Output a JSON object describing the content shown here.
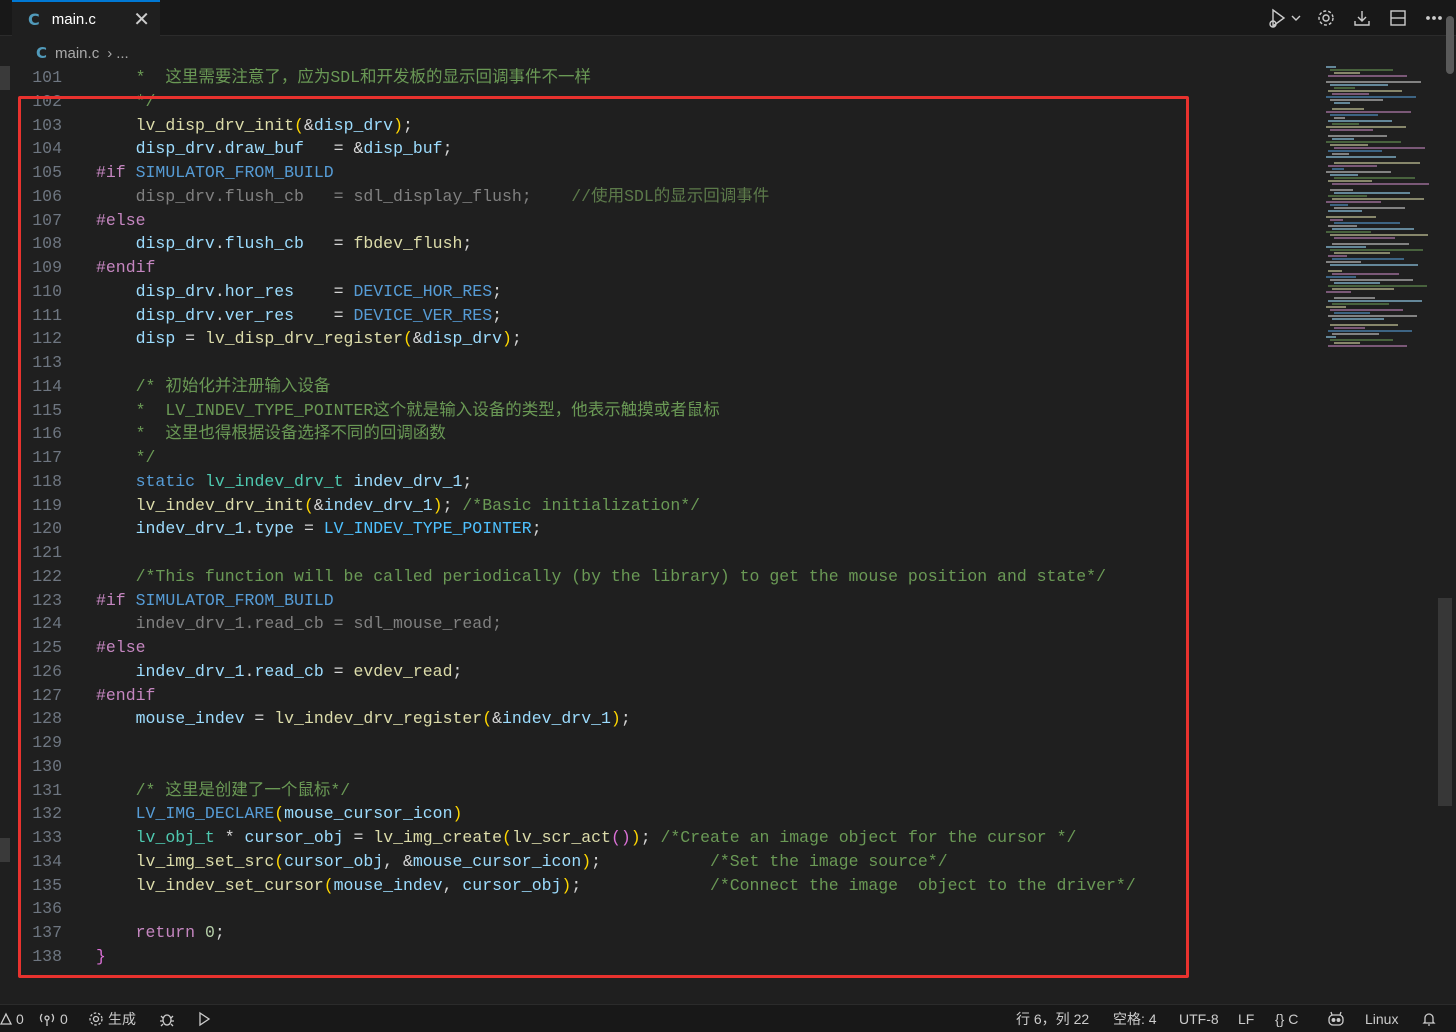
{
  "tab": {
    "icon": "C",
    "label": "main.c",
    "close": "✕"
  },
  "toolbar": [
    "run-debug-icon",
    "chevron-down-icon",
    "gear-icon",
    "download-icon",
    "split-editor-icon",
    "more-icon"
  ],
  "breadcrumb": {
    "icon": "C",
    "file": "main.c",
    "separator": "›",
    "more": "..."
  },
  "editor": {
    "lines": [
      {
        "n": "101",
        "seg": [
          {
            "t": "    ",
            "c": "#d4d4d4"
          },
          {
            "t": "*  这里需要注意了，应为SDL和开发板的显示回调事件不一样",
            "c": "#6a9955"
          }
        ]
      },
      {
        "n": "102",
        "seg": [
          {
            "t": "    ",
            "c": "#d4d4d4"
          },
          {
            "t": "*/",
            "c": "#6a9955"
          }
        ]
      },
      {
        "n": "103",
        "seg": [
          {
            "t": "    ",
            "c": "#d4d4d4"
          },
          {
            "t": "lv_disp_drv_init",
            "c": "#dcdcaa"
          },
          {
            "t": "(",
            "c": "#ffd700"
          },
          {
            "t": "&",
            "c": "#d4d4d4"
          },
          {
            "t": "disp_drv",
            "c": "#9cdcfe"
          },
          {
            "t": ")",
            "c": "#ffd700"
          },
          {
            "t": ";",
            "c": "#d4d4d4"
          }
        ]
      },
      {
        "n": "104",
        "seg": [
          {
            "t": "    ",
            "c": "#d4d4d4"
          },
          {
            "t": "disp_drv",
            "c": "#9cdcfe"
          },
          {
            "t": ".",
            "c": "#d4d4d4"
          },
          {
            "t": "draw_buf",
            "c": "#9cdcfe"
          },
          {
            "t": "   = &",
            "c": "#d4d4d4"
          },
          {
            "t": "disp_buf",
            "c": "#9cdcfe"
          },
          {
            "t": ";",
            "c": "#d4d4d4"
          }
        ]
      },
      {
        "n": "105",
        "seg": [
          {
            "t": "#if ",
            "c": "#c586c0"
          },
          {
            "t": "SIMULATOR_FROM_BUILD",
            "c": "#569cd6"
          }
        ]
      },
      {
        "n": "106",
        "seg": [
          {
            "t": "    disp_drv.flush_cb   = sdl_display_flush;    ",
            "c": "#808080"
          },
          {
            "t": "//使用SDL的显示回调事件",
            "c": "#5c7a4a"
          }
        ]
      },
      {
        "n": "107",
        "seg": [
          {
            "t": "#else",
            "c": "#c586c0"
          }
        ]
      },
      {
        "n": "108",
        "seg": [
          {
            "t": "    ",
            "c": "#d4d4d4"
          },
          {
            "t": "disp_drv",
            "c": "#9cdcfe"
          },
          {
            "t": ".",
            "c": "#d4d4d4"
          },
          {
            "t": "flush_cb",
            "c": "#9cdcfe"
          },
          {
            "t": "   = ",
            "c": "#d4d4d4"
          },
          {
            "t": "fbdev_flush",
            "c": "#dcdcaa"
          },
          {
            "t": ";",
            "c": "#d4d4d4"
          }
        ]
      },
      {
        "n": "109",
        "seg": [
          {
            "t": "#endif",
            "c": "#c586c0"
          }
        ]
      },
      {
        "n": "110",
        "seg": [
          {
            "t": "    ",
            "c": "#d4d4d4"
          },
          {
            "t": "disp_drv",
            "c": "#9cdcfe"
          },
          {
            "t": ".",
            "c": "#d4d4d4"
          },
          {
            "t": "hor_res",
            "c": "#9cdcfe"
          },
          {
            "t": "    = ",
            "c": "#d4d4d4"
          },
          {
            "t": "DEVICE_HOR_RES",
            "c": "#569cd6"
          },
          {
            "t": ";",
            "c": "#d4d4d4"
          }
        ]
      },
      {
        "n": "111",
        "seg": [
          {
            "t": "    ",
            "c": "#d4d4d4"
          },
          {
            "t": "disp_drv",
            "c": "#9cdcfe"
          },
          {
            "t": ".",
            "c": "#d4d4d4"
          },
          {
            "t": "ver_res",
            "c": "#9cdcfe"
          },
          {
            "t": "    = ",
            "c": "#d4d4d4"
          },
          {
            "t": "DEVICE_VER_RES",
            "c": "#569cd6"
          },
          {
            "t": ";",
            "c": "#d4d4d4"
          }
        ]
      },
      {
        "n": "112",
        "seg": [
          {
            "t": "    ",
            "c": "#d4d4d4"
          },
          {
            "t": "disp",
            "c": "#9cdcfe"
          },
          {
            "t": " = ",
            "c": "#d4d4d4"
          },
          {
            "t": "lv_disp_drv_register",
            "c": "#dcdcaa"
          },
          {
            "t": "(",
            "c": "#ffd700"
          },
          {
            "t": "&",
            "c": "#d4d4d4"
          },
          {
            "t": "disp_drv",
            "c": "#9cdcfe"
          },
          {
            "t": ")",
            "c": "#ffd700"
          },
          {
            "t": ";",
            "c": "#d4d4d4"
          }
        ]
      },
      {
        "n": "113",
        "seg": []
      },
      {
        "n": "114",
        "seg": [
          {
            "t": "    ",
            "c": "#d4d4d4"
          },
          {
            "t": "/* 初始化并注册输入设备",
            "c": "#6a9955"
          }
        ]
      },
      {
        "n": "115",
        "seg": [
          {
            "t": "    ",
            "c": "#d4d4d4"
          },
          {
            "t": "*  LV_INDEV_TYPE_POINTER这个就是输入设备的类型，他表示触摸或者鼠标",
            "c": "#6a9955"
          }
        ]
      },
      {
        "n": "116",
        "seg": [
          {
            "t": "    ",
            "c": "#d4d4d4"
          },
          {
            "t": "*  这里也得根据设备选择不同的回调函数",
            "c": "#6a9955"
          }
        ]
      },
      {
        "n": "117",
        "seg": [
          {
            "t": "    ",
            "c": "#d4d4d4"
          },
          {
            "t": "*/",
            "c": "#6a9955"
          }
        ]
      },
      {
        "n": "118",
        "seg": [
          {
            "t": "    ",
            "c": "#d4d4d4"
          },
          {
            "t": "static",
            "c": "#569cd6"
          },
          {
            "t": " ",
            "c": "#d4d4d4"
          },
          {
            "t": "lv_indev_drv_t",
            "c": "#4ec9b0"
          },
          {
            "t": " ",
            "c": "#d4d4d4"
          },
          {
            "t": "indev_drv_1",
            "c": "#9cdcfe"
          },
          {
            "t": ";",
            "c": "#d4d4d4"
          }
        ]
      },
      {
        "n": "119",
        "seg": [
          {
            "t": "    ",
            "c": "#d4d4d4"
          },
          {
            "t": "lv_indev_drv_init",
            "c": "#dcdcaa"
          },
          {
            "t": "(",
            "c": "#ffd700"
          },
          {
            "t": "&",
            "c": "#d4d4d4"
          },
          {
            "t": "indev_drv_1",
            "c": "#9cdcfe"
          },
          {
            "t": ")",
            "c": "#ffd700"
          },
          {
            "t": "; ",
            "c": "#d4d4d4"
          },
          {
            "t": "/*Basic initialization*/",
            "c": "#6a9955"
          }
        ]
      },
      {
        "n": "120",
        "seg": [
          {
            "t": "    ",
            "c": "#d4d4d4"
          },
          {
            "t": "indev_drv_1",
            "c": "#9cdcfe"
          },
          {
            "t": ".",
            "c": "#d4d4d4"
          },
          {
            "t": "type",
            "c": "#9cdcfe"
          },
          {
            "t": " = ",
            "c": "#d4d4d4"
          },
          {
            "t": "LV_INDEV_TYPE_POINTER",
            "c": "#4fc1ff"
          },
          {
            "t": ";",
            "c": "#d4d4d4"
          }
        ]
      },
      {
        "n": "121",
        "seg": []
      },
      {
        "n": "122",
        "seg": [
          {
            "t": "    ",
            "c": "#d4d4d4"
          },
          {
            "t": "/*This function will be called periodically (by the library) to get the mouse position and state*/",
            "c": "#6a9955"
          }
        ]
      },
      {
        "n": "123",
        "seg": [
          {
            "t": "#if ",
            "c": "#c586c0"
          },
          {
            "t": "SIMULATOR_FROM_BUILD",
            "c": "#569cd6"
          }
        ]
      },
      {
        "n": "124",
        "seg": [
          {
            "t": "    indev_drv_1.read_cb = sdl_mouse_read;",
            "c": "#808080"
          }
        ]
      },
      {
        "n": "125",
        "seg": [
          {
            "t": "#else",
            "c": "#c586c0"
          }
        ]
      },
      {
        "n": "126",
        "seg": [
          {
            "t": "    ",
            "c": "#d4d4d4"
          },
          {
            "t": "indev_drv_1",
            "c": "#9cdcfe"
          },
          {
            "t": ".",
            "c": "#d4d4d4"
          },
          {
            "t": "read_cb",
            "c": "#9cdcfe"
          },
          {
            "t": " = ",
            "c": "#d4d4d4"
          },
          {
            "t": "evdev_read",
            "c": "#dcdcaa"
          },
          {
            "t": ";",
            "c": "#d4d4d4"
          }
        ]
      },
      {
        "n": "127",
        "seg": [
          {
            "t": "#endif",
            "c": "#c586c0"
          }
        ]
      },
      {
        "n": "128",
        "seg": [
          {
            "t": "    ",
            "c": "#d4d4d4"
          },
          {
            "t": "mouse_indev",
            "c": "#9cdcfe"
          },
          {
            "t": " = ",
            "c": "#d4d4d4"
          },
          {
            "t": "lv_indev_drv_register",
            "c": "#dcdcaa"
          },
          {
            "t": "(",
            "c": "#ffd700"
          },
          {
            "t": "&",
            "c": "#d4d4d4"
          },
          {
            "t": "indev_drv_1",
            "c": "#9cdcfe"
          },
          {
            "t": ")",
            "c": "#ffd700"
          },
          {
            "t": ";",
            "c": "#d4d4d4"
          }
        ]
      },
      {
        "n": "129",
        "seg": []
      },
      {
        "n": "130",
        "seg": []
      },
      {
        "n": "131",
        "seg": [
          {
            "t": "    ",
            "c": "#d4d4d4"
          },
          {
            "t": "/* 这里是创建了一个鼠标*/",
            "c": "#6a9955"
          }
        ]
      },
      {
        "n": "132",
        "seg": [
          {
            "t": "    ",
            "c": "#d4d4d4"
          },
          {
            "t": "LV_IMG_DECLARE",
            "c": "#569cd6"
          },
          {
            "t": "(",
            "c": "#ffd700"
          },
          {
            "t": "mouse_cursor_icon",
            "c": "#9cdcfe"
          },
          {
            "t": ")",
            "c": "#ffd700"
          }
        ]
      },
      {
        "n": "133",
        "seg": [
          {
            "t": "    ",
            "c": "#d4d4d4"
          },
          {
            "t": "lv_obj_t",
            "c": "#4ec9b0"
          },
          {
            "t": " * ",
            "c": "#d4d4d4"
          },
          {
            "t": "cursor_obj",
            "c": "#9cdcfe"
          },
          {
            "t": " = ",
            "c": "#d4d4d4"
          },
          {
            "t": "lv_img_create",
            "c": "#dcdcaa"
          },
          {
            "t": "(",
            "c": "#ffd700"
          },
          {
            "t": "lv_scr_act",
            "c": "#dcdcaa"
          },
          {
            "t": "()",
            "c": "#da70d6"
          },
          {
            "t": ")",
            "c": "#ffd700"
          },
          {
            "t": "; ",
            "c": "#d4d4d4"
          },
          {
            "t": "/*Create an image object for the cursor */",
            "c": "#6a9955"
          }
        ]
      },
      {
        "n": "134",
        "seg": [
          {
            "t": "    ",
            "c": "#d4d4d4"
          },
          {
            "t": "lv_img_set_src",
            "c": "#dcdcaa"
          },
          {
            "t": "(",
            "c": "#ffd700"
          },
          {
            "t": "cursor_obj",
            "c": "#9cdcfe"
          },
          {
            "t": ", &",
            "c": "#d4d4d4"
          },
          {
            "t": "mouse_cursor_icon",
            "c": "#9cdcfe"
          },
          {
            "t": ")",
            "c": "#ffd700"
          },
          {
            "t": ";           ",
            "c": "#d4d4d4"
          },
          {
            "t": "/*Set the image source*/",
            "c": "#6a9955"
          }
        ]
      },
      {
        "n": "135",
        "seg": [
          {
            "t": "    ",
            "c": "#d4d4d4"
          },
          {
            "t": "lv_indev_set_cursor",
            "c": "#dcdcaa"
          },
          {
            "t": "(",
            "c": "#ffd700"
          },
          {
            "t": "mouse_indev",
            "c": "#9cdcfe"
          },
          {
            "t": ", ",
            "c": "#d4d4d4"
          },
          {
            "t": "cursor_obj",
            "c": "#9cdcfe"
          },
          {
            "t": ")",
            "c": "#ffd700"
          },
          {
            "t": ";             ",
            "c": "#d4d4d4"
          },
          {
            "t": "/*Connect the image  object to the driver*/",
            "c": "#6a9955"
          }
        ]
      },
      {
        "n": "136",
        "seg": []
      },
      {
        "n": "137",
        "seg": [
          {
            "t": "    ",
            "c": "#d4d4d4"
          },
          {
            "t": "return",
            "c": "#c586c0"
          },
          {
            "t": " ",
            "c": "#d4d4d4"
          },
          {
            "t": "0",
            "c": "#b5cea8"
          },
          {
            "t": ";",
            "c": "#d4d4d4"
          }
        ]
      },
      {
        "n": "138",
        "seg": [
          {
            "t": "}",
            "c": "#da70d6"
          }
        ]
      }
    ]
  },
  "statusbar": {
    "warnings": "0",
    "ports": "0",
    "build_label": "生成",
    "position": "行 6，列 22",
    "spaces": "空格: 4",
    "encoding": "UTF-8",
    "eol": "LF",
    "language": "{} C",
    "platform": "Linux"
  },
  "colors": {
    "highlight_box": "#e8322e",
    "accent": "#0078d4"
  }
}
